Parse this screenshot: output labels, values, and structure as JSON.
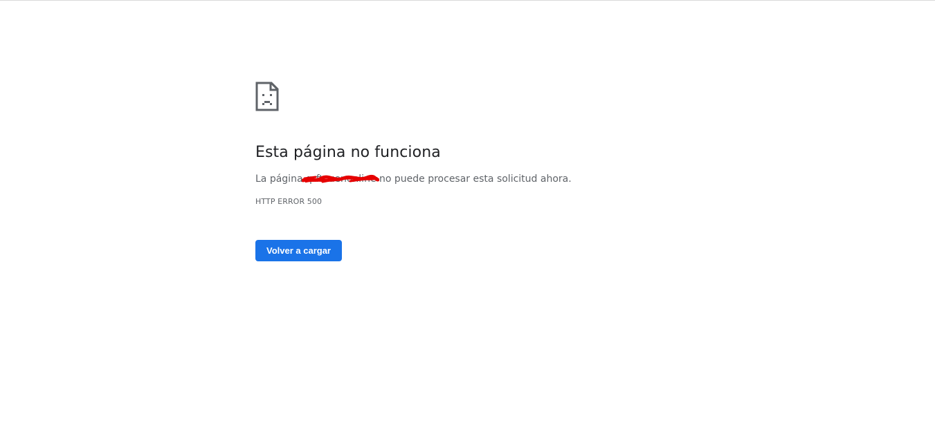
{
  "page": {
    "title": "Esta página no funciona",
    "message_prefix": "La página ",
    "host": "qrftcuenonline",
    "message_suffix": " no puede procesar esta solicitud ahora.",
    "error_code": "HTTP ERROR 500",
    "reload_label": "Volver a cargar"
  },
  "icons": {
    "error": "sad-page-icon",
    "redaction": "red-scribble"
  },
  "colors": {
    "button": "#1a73e8",
    "title": "#202124",
    "text": "#5f6368",
    "redaction": "#e60000"
  }
}
